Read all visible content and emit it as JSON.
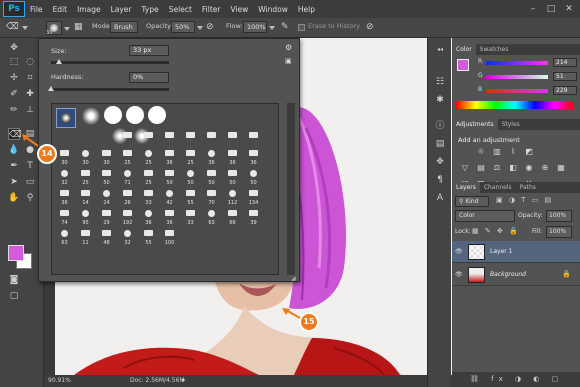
{
  "app": {
    "logo": "Ps"
  },
  "menu": [
    "File",
    "Edit",
    "Image",
    "Layer",
    "Type",
    "Select",
    "Filter",
    "View",
    "Window",
    "Help"
  ],
  "window_controls": [
    "–",
    "□",
    "✕"
  ],
  "options_bar": {
    "brush_size": "33",
    "mode_label": "Mode:",
    "mode_value": "Brush",
    "opacity_label": "Opacity:",
    "opacity_value": "50%",
    "flow_label": "Flow:",
    "flow_value": "100%",
    "erase_history_label": "Erase to History"
  },
  "brush_popup": {
    "size_label": "Size:",
    "size_value": "33 px",
    "size_fraction": 0.07,
    "hardness_label": "Hardness:",
    "hardness_value": "0%",
    "hardness_fraction": 0.0,
    "preset_numbers": [
      "30",
      "30",
      "30",
      "25",
      "25",
      "36",
      "25",
      "36",
      "36",
      "36",
      "32",
      "25",
      "50",
      "71",
      "25",
      "50",
      "50",
      "50",
      "50",
      "50",
      "36",
      "14",
      "24",
      "26",
      "33",
      "42",
      "55",
      "70",
      "112",
      "134",
      "74",
      "95",
      "29",
      "192",
      "36",
      "36",
      "33",
      "63",
      "66",
      "39",
      "63",
      "11",
      "48",
      "32",
      "55",
      "100"
    ]
  },
  "callouts": [
    "14",
    "15"
  ],
  "status": {
    "zoom": "90.91%",
    "doc": "Doc: 2.56M/4.56M"
  },
  "color_panel": {
    "tabs": [
      "Color",
      "Swatches"
    ],
    "swatch": "#d35adc",
    "channels": [
      {
        "letter": "R",
        "value": "214"
      },
      {
        "letter": "G",
        "value": "51"
      },
      {
        "letter": "B",
        "value": "229"
      }
    ]
  },
  "adjustments_panel": {
    "tabs": [
      "Adjustments",
      "Styles"
    ],
    "title": "Add an adjustment",
    "icons": [
      "brightness-icon",
      "levels-icon",
      "curves-icon",
      "exposure-icon",
      "vibrance-icon",
      "hue-sat-icon",
      "color-balance-icon",
      "bw-icon",
      "photo-filter-icon",
      "channel-mixer-icon",
      "color-lookup-icon",
      "invert-icon",
      "posterize-icon",
      "threshold-icon",
      "gradient-map-icon",
      "selective-color-icon"
    ]
  },
  "layers_panel": {
    "tabs": [
      "Layers",
      "Channels",
      "Paths"
    ],
    "kind_label": "Kind",
    "blend_mode": "Color",
    "opacity_label": "Opacity:",
    "opacity_value": "100%",
    "lock_label": "Lock:",
    "fill_label": "Fill:",
    "fill_value": "100%",
    "layers": [
      {
        "name": "Layer 1",
        "selected": true
      },
      {
        "name": "Background",
        "selected": false
      }
    ]
  }
}
